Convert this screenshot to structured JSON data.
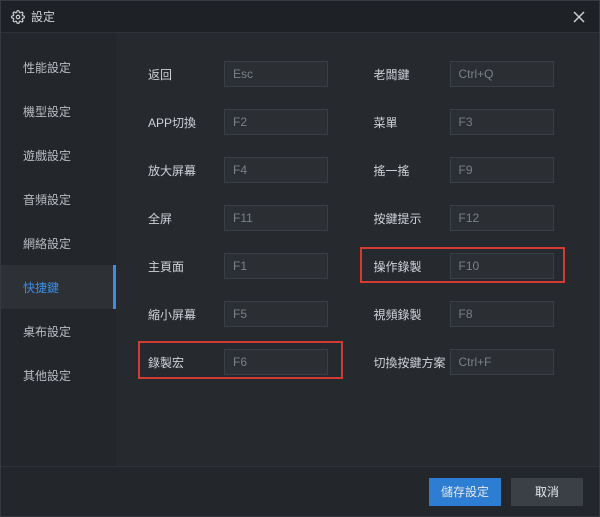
{
  "titlebar": {
    "title": "設定"
  },
  "sidebar": {
    "items": [
      {
        "label": "性能設定"
      },
      {
        "label": "機型設定"
      },
      {
        "label": "遊戲設定"
      },
      {
        "label": "音頻設定"
      },
      {
        "label": "網絡設定"
      },
      {
        "label": "快捷鍵"
      },
      {
        "label": "桌布設定"
      },
      {
        "label": "其他設定"
      }
    ],
    "active_index": 5
  },
  "shortcuts": {
    "left": [
      {
        "name": "back",
        "label": "返回",
        "value": "Esc"
      },
      {
        "name": "app-switch",
        "label": "APP切換",
        "value": "F2"
      },
      {
        "name": "zoom-in",
        "label": "放大屏幕",
        "value": "F4"
      },
      {
        "name": "fullscreen",
        "label": "全屏",
        "value": "F11"
      },
      {
        "name": "home",
        "label": "主頁面",
        "value": "F1"
      },
      {
        "name": "zoom-out",
        "label": "縮小屏幕",
        "value": "F5"
      },
      {
        "name": "record-macro",
        "label": "錄製宏",
        "value": "F6"
      }
    ],
    "right": [
      {
        "name": "boss-key",
        "label": "老闆鍵",
        "value": "Ctrl+Q"
      },
      {
        "name": "menu",
        "label": "菜單",
        "value": "F3"
      },
      {
        "name": "shake",
        "label": "搖一搖",
        "value": "F9"
      },
      {
        "name": "key-hint",
        "label": "按鍵提示",
        "value": "F12"
      },
      {
        "name": "op-record",
        "label": "操作錄製",
        "value": "F10"
      },
      {
        "name": "video-record",
        "label": "視頻錄製",
        "value": "F8"
      },
      {
        "name": "switch-keymap",
        "label": "切換按鍵方案",
        "value": "Ctrl+F"
      }
    ]
  },
  "footer": {
    "save": "儲存設定",
    "cancel": "取消"
  },
  "highlights": [
    {
      "target": "record-macro"
    },
    {
      "target": "op-record"
    }
  ]
}
